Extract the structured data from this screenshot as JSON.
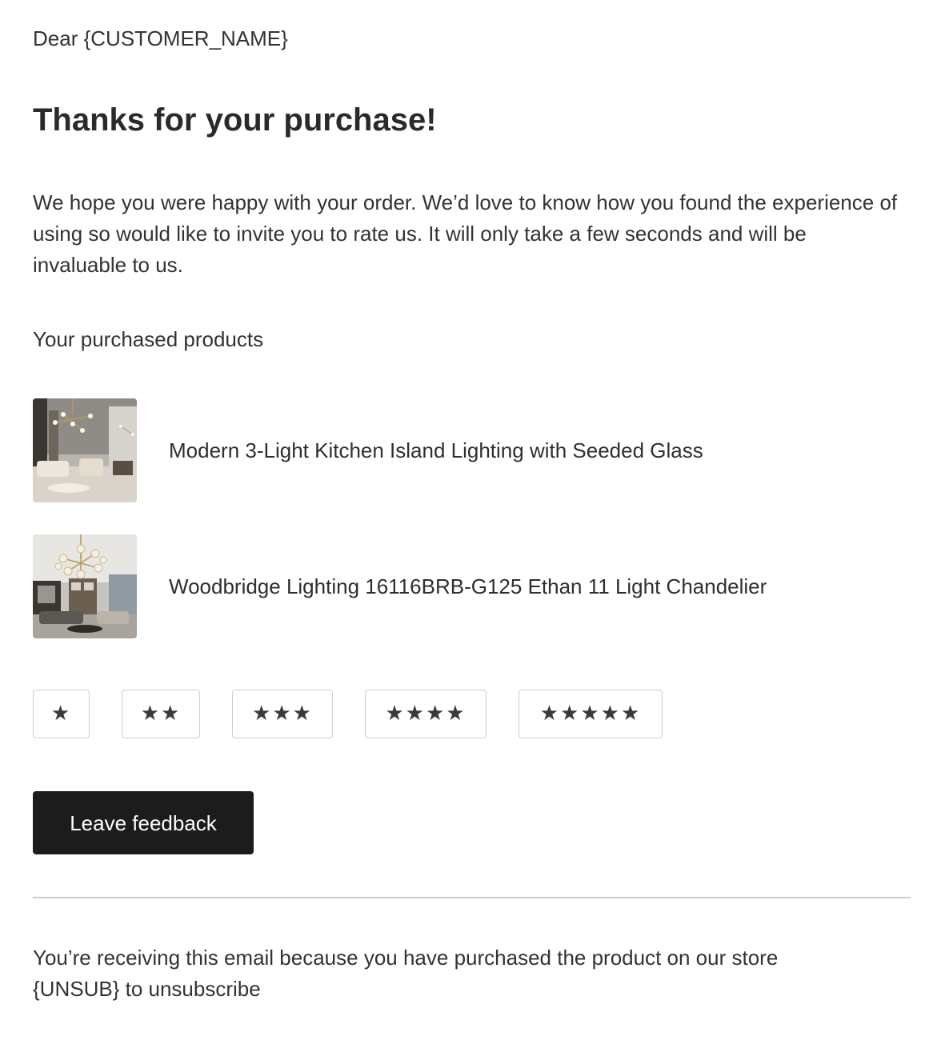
{
  "email": {
    "greeting": "Dear {CUSTOMER_NAME}",
    "title": "Thanks for your purchase!",
    "intro": "We hope you were happy with your order. We’d love to know how you found the experience of using so would like to invite you to rate us. It will only take a few seconds and will be invaluable to us.",
    "products_heading": "Your purchased products",
    "products": [
      {
        "name": "Modern 3-Light Kitchen Island Lighting with Seeded Glass",
        "image_icon": "living-room-chandelier-photo"
      },
      {
        "name": "Woodbridge Lighting 16116BRB-G125 Ethan 11 Light Chandelier",
        "image_icon": "sputnik-chandelier-photo"
      }
    ],
    "ratings": [
      "★",
      "★★",
      "★★★",
      "★★★★",
      "★★★★★"
    ],
    "feedback_button": "Leave feedback",
    "footer": {
      "line1": "You’re receiving this email because you have purchased the product on our store",
      "line2": "{UNSUB} to unsubscribe"
    },
    "colors": {
      "button_bg": "#1c1c1c",
      "button_text": "#ffffff",
      "text": "#333333",
      "border": "#cfcfcf",
      "divider": "#cccccc"
    }
  }
}
